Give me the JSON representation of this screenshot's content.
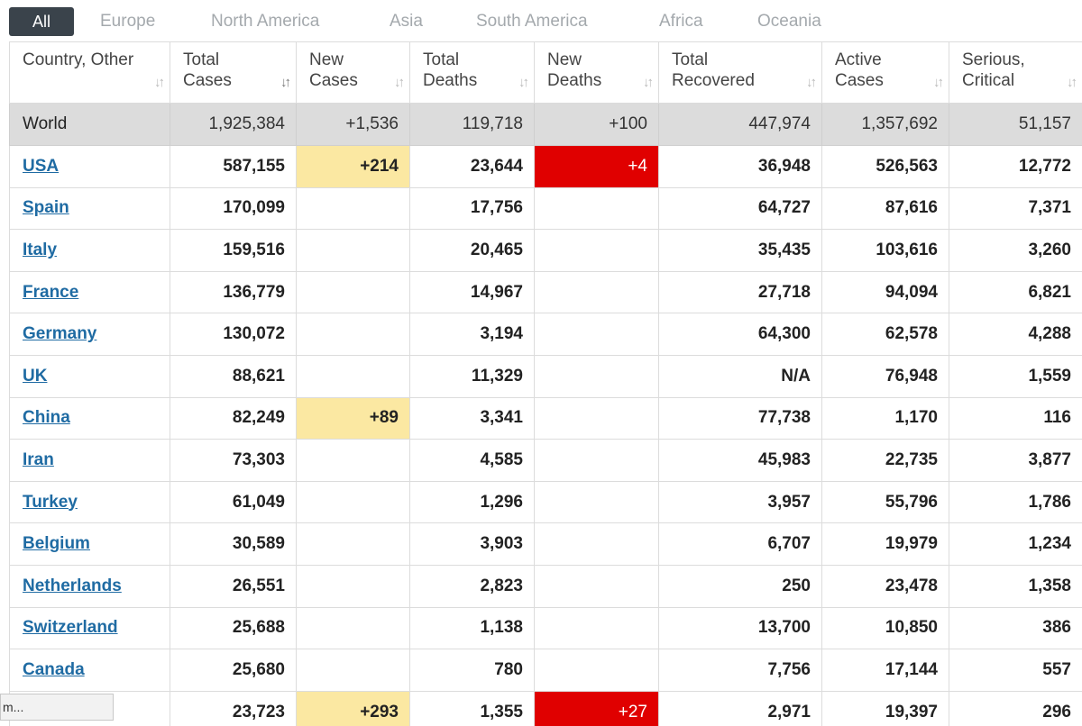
{
  "tabs": [
    {
      "label": "All",
      "active": true
    },
    {
      "label": "Europe"
    },
    {
      "label": "North America"
    },
    {
      "label": "Asia"
    },
    {
      "label": "South America"
    },
    {
      "label": "Africa"
    },
    {
      "label": "Oceania"
    }
  ],
  "columns": [
    {
      "label": "Country, Other",
      "sort": "↓↑"
    },
    {
      "label": "Total Cases",
      "sort": "↓↑",
      "active": true
    },
    {
      "label": "New Cases",
      "sort": "↓↑"
    },
    {
      "label": "Total Deaths",
      "sort": "↓↑"
    },
    {
      "label": "New Deaths",
      "sort": "↓↑"
    },
    {
      "label": "Total Recovered",
      "sort": "↓↑"
    },
    {
      "label": "Active Cases",
      "sort": "↓↑"
    },
    {
      "label": "Serious, Critical",
      "sort": "↓↑"
    }
  ],
  "world": [
    "World",
    "1,925,384",
    "+1,536",
    "119,718",
    "+100",
    "447,974",
    "1,357,692",
    "51,157"
  ],
  "rows": [
    [
      "USA",
      "587,155",
      "+214",
      "23,644",
      "+4",
      "36,948",
      "526,563",
      "12,772"
    ],
    [
      "Spain",
      "170,099",
      "",
      "17,756",
      "",
      "64,727",
      "87,616",
      "7,371"
    ],
    [
      "Italy",
      "159,516",
      "",
      "20,465",
      "",
      "35,435",
      "103,616",
      "3,260"
    ],
    [
      "France",
      "136,779",
      "",
      "14,967",
      "",
      "27,718",
      "94,094",
      "6,821"
    ],
    [
      "Germany",
      "130,072",
      "",
      "3,194",
      "",
      "64,300",
      "62,578",
      "4,288"
    ],
    [
      "UK",
      "88,621",
      "",
      "11,329",
      "",
      "N/A",
      "76,948",
      "1,559"
    ],
    [
      "China",
      "82,249",
      "+89",
      "3,341",
      "",
      "77,738",
      "1,170",
      "116"
    ],
    [
      "Iran",
      "73,303",
      "",
      "4,585",
      "",
      "45,983",
      "22,735",
      "3,877"
    ],
    [
      "Turkey",
      "61,049",
      "",
      "1,296",
      "",
      "3,957",
      "55,796",
      "1,786"
    ],
    [
      "Belgium",
      "30,589",
      "",
      "3,903",
      "",
      "6,707",
      "19,979",
      "1,234"
    ],
    [
      "Netherlands",
      "26,551",
      "",
      "2,823",
      "",
      "250",
      "23,478",
      "1,358"
    ],
    [
      "Switzerland",
      "25,688",
      "",
      "1,138",
      "",
      "13,700",
      "10,850",
      "386"
    ],
    [
      "Canada",
      "25,680",
      "",
      "780",
      "",
      "7,756",
      "17,144",
      "557"
    ],
    [
      "",
      "23,723",
      "+293",
      "1,355",
      "+27",
      "2,971",
      "19,397",
      "296"
    ]
  ],
  "status_tooltip": "m...",
  "colors": {
    "tab_active_bg": "#3a434b",
    "link": "#1f6ba3",
    "new_cases_highlight": "#fbe8a2",
    "new_deaths_highlight": "#e00000",
    "world_row_bg": "#dcdcdc"
  }
}
